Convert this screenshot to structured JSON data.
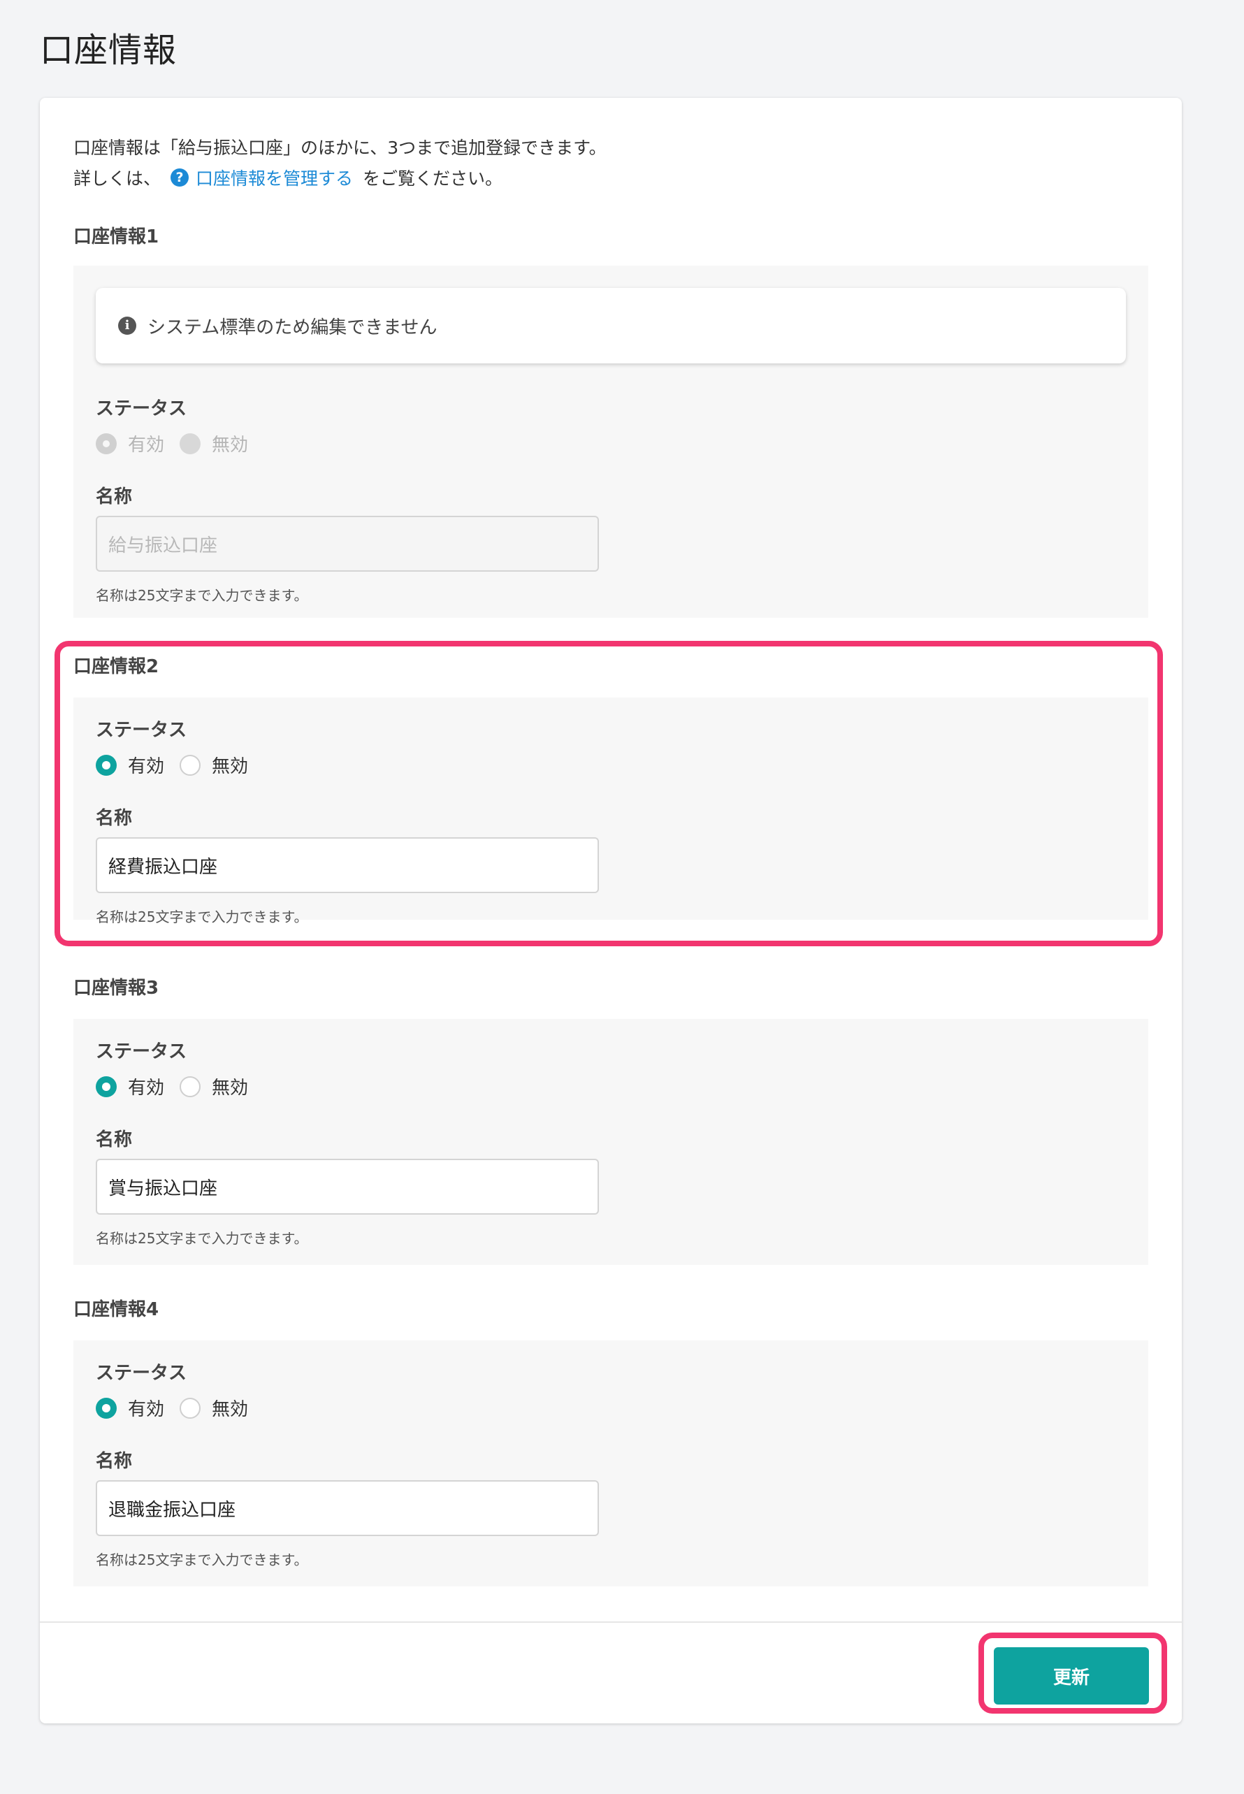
{
  "page": {
    "title": "口座情報"
  },
  "intro": {
    "line1": "口座情報は「給与振込口座」のほかに、3つまで追加登録できます。",
    "line2_prefix": "詳しくは、",
    "link_icon": "question-circle-icon",
    "link_text": "口座情報を管理する",
    "line2_suffix": "をご覧ください。"
  },
  "accounts": [
    {
      "title": "口座情報1",
      "notice": "システム標準のため編集できません",
      "status_label": "ステータス",
      "status_on": "有効",
      "status_off": "無効",
      "selected": "有効",
      "disabled": true,
      "name_label": "名称",
      "name_value": "給与振込口座",
      "hint": "名称は25文字まで入力できます。"
    },
    {
      "title": "口座情報2",
      "status_label": "ステータス",
      "status_on": "有効",
      "status_off": "無効",
      "selected": "有効",
      "disabled": false,
      "name_label": "名称",
      "name_value": "経費振込口座",
      "hint": "名称は25文字まで入力できます。"
    },
    {
      "title": "口座情報3",
      "status_label": "ステータス",
      "status_on": "有効",
      "status_off": "無効",
      "selected": "有効",
      "disabled": false,
      "name_label": "名称",
      "name_value": "賞与振込口座",
      "hint": "名称は25文字まで入力できます。"
    },
    {
      "title": "口座情報4",
      "status_label": "ステータス",
      "status_on": "有効",
      "status_off": "無効",
      "selected": "有効",
      "disabled": false,
      "name_label": "名称",
      "name_value": "退職金振込口座",
      "hint": "名称は25文字まで入力できます。"
    }
  ],
  "actions": {
    "update_label": "更新"
  },
  "colors": {
    "accent": "#0ea39f",
    "link": "#1c8ad6",
    "highlight": "#f2356f"
  }
}
